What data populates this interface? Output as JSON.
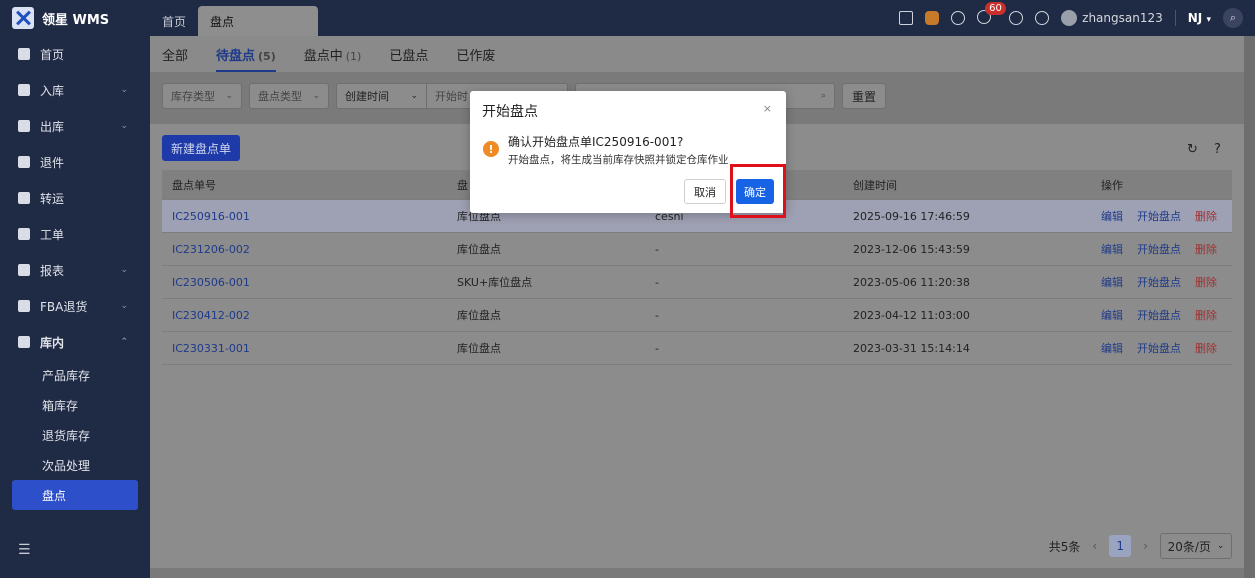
{
  "app": {
    "name": "领星 WMS"
  },
  "topbar": {
    "tabs": [
      {
        "label": "首页"
      },
      {
        "label": "盘点"
      }
    ],
    "notification_count": "60",
    "username": "zhangsan123",
    "warehouse": "NJ"
  },
  "sidebar": {
    "items": [
      {
        "label": "首页"
      },
      {
        "label": "入库"
      },
      {
        "label": "出库"
      },
      {
        "label": "退件"
      },
      {
        "label": "转运"
      },
      {
        "label": "工单"
      },
      {
        "label": "报表"
      },
      {
        "label": "FBA退货"
      },
      {
        "label": "库内"
      }
    ],
    "sub_items": [
      {
        "label": "产品库存"
      },
      {
        "label": "箱库存"
      },
      {
        "label": "退货库存"
      },
      {
        "label": "次品处理"
      },
      {
        "label": "盘点"
      }
    ]
  },
  "status_tabs": [
    {
      "label": "全部",
      "count": ""
    },
    {
      "label": "待盘点",
      "count": "(5)"
    },
    {
      "label": "盘点中",
      "count": "(1)"
    },
    {
      "label": "已盘点",
      "count": ""
    },
    {
      "label": "已作废",
      "count": ""
    }
  ],
  "filters": {
    "inventory_type": "库存类型",
    "count_type": "盘点类型",
    "time_type": "创建时间",
    "start_placeholder": "开始时",
    "reset_label": "重置"
  },
  "toolbar": {
    "new_label": "新建盘点单"
  },
  "table": {
    "headers": [
      "盘点单号",
      "盘",
      "",
      "创建时间",
      "操作"
    ],
    "rows": [
      {
        "id": "IC250916-001",
        "type": "库位盘点",
        "creator": "cesni",
        "created": "2025-09-16 17:46:59"
      },
      {
        "id": "IC231206-002",
        "type": "库位盘点",
        "creator": "-",
        "created": "2023-12-06 15:43:59"
      },
      {
        "id": "IC230506-001",
        "type": "SKU+库位盘点",
        "creator": "-",
        "created": "2023-05-06 11:20:38"
      },
      {
        "id": "IC230412-002",
        "type": "库位盘点",
        "creator": "-",
        "created": "2023-04-12 11:03:00"
      },
      {
        "id": "IC230331-001",
        "type": "库位盘点",
        "creator": "-",
        "created": "2023-03-31 15:14:14"
      }
    ],
    "actions": {
      "edit": "编辑",
      "start": "开始盘点",
      "delete": "删除"
    }
  },
  "pagination": {
    "total": "共5条",
    "current": "1",
    "per_page": "20条/页"
  },
  "dialog": {
    "title": "开始盘点",
    "close": "×",
    "message": "确认开始盘点单IC250916-001?",
    "detail": "开始盘点，将生成当前库存快照并锁定仓库作业",
    "cancel_label": "取消",
    "ok_label": "确定"
  }
}
